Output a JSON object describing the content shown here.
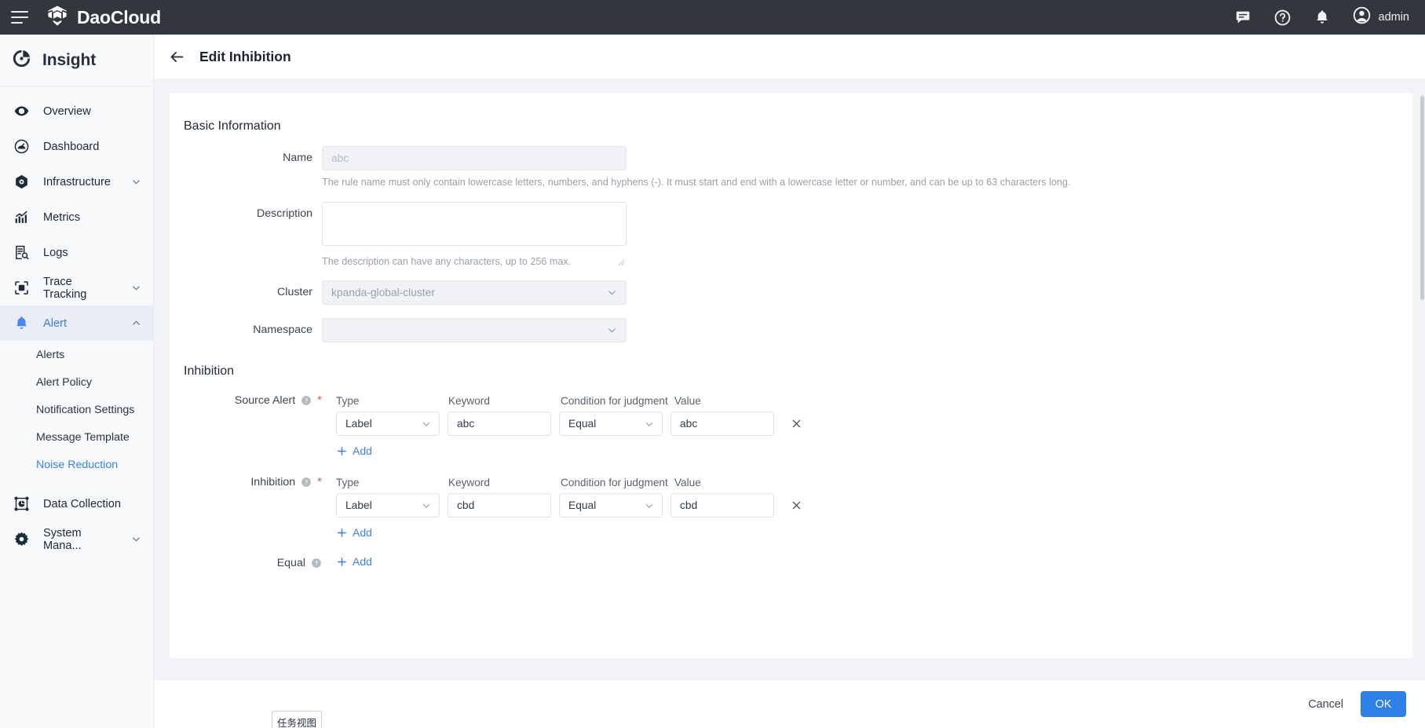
{
  "topbar": {
    "menu_icon": "hamburger-icon",
    "brand": "DaoCloud",
    "icons": [
      "message-icon",
      "help-icon",
      "bell-icon"
    ],
    "user": "admin"
  },
  "sidebar": {
    "product": "Insight",
    "items": [
      {
        "label": "Overview",
        "icon": "eye-icon",
        "expandable": false,
        "active": false
      },
      {
        "label": "Dashboard",
        "icon": "gauge-icon",
        "expandable": false,
        "active": false
      },
      {
        "label": "Infrastructure",
        "icon": "hexagon-icon",
        "expandable": true,
        "active": false
      },
      {
        "label": "Metrics",
        "icon": "chart-up-icon",
        "expandable": false,
        "active": false
      },
      {
        "label": "Logs",
        "icon": "log-search-icon",
        "expandable": false,
        "active": false
      },
      {
        "label": "Trace Tracking",
        "icon": "trace-icon",
        "expandable": true,
        "active": false
      },
      {
        "label": "Alert",
        "icon": "bell-icon",
        "expandable": true,
        "active": true
      }
    ],
    "alert_children": [
      {
        "label": "Alerts",
        "current": false
      },
      {
        "label": "Alert Policy",
        "current": false
      },
      {
        "label": "Notification Settings",
        "current": false
      },
      {
        "label": "Message Template",
        "current": false
      },
      {
        "label": "Noise Reduction",
        "current": true
      }
    ],
    "items_bottom": [
      {
        "label": "Data Collection",
        "icon": "data-collection-icon",
        "expandable": false
      },
      {
        "label": "System Mana...",
        "icon": "gear-icon",
        "expandable": true
      }
    ]
  },
  "header": {
    "back_icon": "arrow-left-icon",
    "title": "Edit Inhibition"
  },
  "basic": {
    "section_title": "Basic Information",
    "name": {
      "label": "Name",
      "value": "abc",
      "placeholder": "abc",
      "disabled": true,
      "hint": "The rule name must only contain lowercase letters, numbers, and hyphens (-). It must start and end with a lowercase letter or number, and can be up to 63 characters long."
    },
    "description": {
      "label": "Description",
      "value": "",
      "placeholder": "",
      "hint": "The description can have any characters, up to 256 max."
    },
    "cluster": {
      "label": "Cluster",
      "value": "kpanda-global-cluster",
      "disabled": true,
      "caret": "chevron-down-icon"
    },
    "namespace": {
      "label": "Namespace",
      "value": "",
      "disabled": true,
      "caret": "chevron-down-icon"
    }
  },
  "inhibition": {
    "section_title": "Inhibition",
    "column_headers": {
      "type": "Type",
      "keyword": "Keyword",
      "condition": "Condition for judgment",
      "value": "Value"
    },
    "add_label": "Add",
    "source_alert": {
      "label": "Source Alert",
      "required": true,
      "help_icon": "question-circle-icon",
      "rows": [
        {
          "type": "Label",
          "keyword": "abc",
          "condition": "Equal",
          "value": "abc",
          "delete_icon": "close-icon"
        }
      ]
    },
    "inhibition_target": {
      "label": "Inhibition",
      "required": true,
      "help_icon": "question-circle-icon",
      "rows": [
        {
          "type": "Label",
          "keyword": "cbd",
          "condition": "Equal",
          "value": "cbd",
          "delete_icon": "close-icon"
        }
      ]
    },
    "equal": {
      "label": "Equal",
      "help_icon": "question-circle-icon",
      "add_label": "Add"
    }
  },
  "footer": {
    "cancel": "Cancel",
    "ok": "OK"
  },
  "overlay": {
    "task_view": "任务视图"
  },
  "colors": {
    "accent": "#3e7eee",
    "primary_button": "#2f7fe8",
    "topbar_bg": "#32373d",
    "sidebar_bg": "#f7f9fb",
    "required_mark": "#e4584f"
  }
}
